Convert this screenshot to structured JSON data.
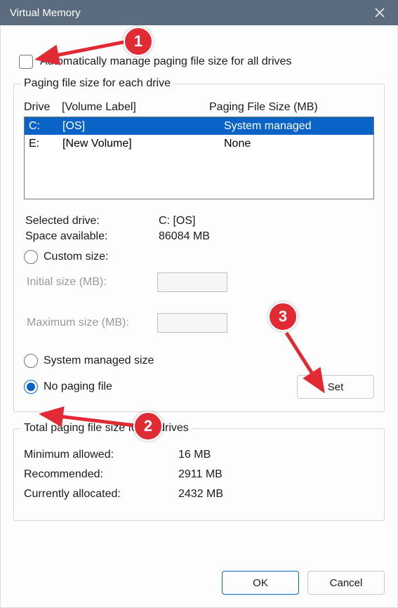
{
  "titlebar": {
    "title": "Virtual Memory"
  },
  "auto_manage": {
    "label": "Automatically manage paging file size for all drives",
    "checked": false
  },
  "group_drives": {
    "legend": "Paging file size for each drive",
    "headers": {
      "drive": "Drive",
      "volume": "[Volume Label]",
      "paging": "Paging File Size (MB)"
    },
    "rows": [
      {
        "drive": "C:",
        "volume": "[OS]",
        "paging": "System managed",
        "selected": true
      },
      {
        "drive": "E:",
        "volume": "[New Volume]",
        "paging": "None",
        "selected": false
      }
    ],
    "selected_drive_label": "Selected drive:",
    "selected_drive_value": "C:  [OS]",
    "space_label": "Space available:",
    "space_value": "86084 MB",
    "radio_custom": "Custom size:",
    "initial_label": "Initial size (MB):",
    "initial_value": "",
    "max_label": "Maximum size (MB):",
    "max_value": "",
    "radio_system": "System managed size",
    "radio_none": "No paging file",
    "radio_selected": "none",
    "set_button": "Set"
  },
  "group_totals": {
    "legend": "Total paging file size for all drives",
    "min_label": "Minimum allowed:",
    "min_value": "16 MB",
    "rec_label": "Recommended:",
    "rec_value": "2911 MB",
    "cur_label": "Currently allocated:",
    "cur_value": "2432 MB"
  },
  "buttons": {
    "ok": "OK",
    "cancel": "Cancel"
  },
  "annotations": {
    "a1": "1",
    "a2": "2",
    "a3": "3"
  }
}
